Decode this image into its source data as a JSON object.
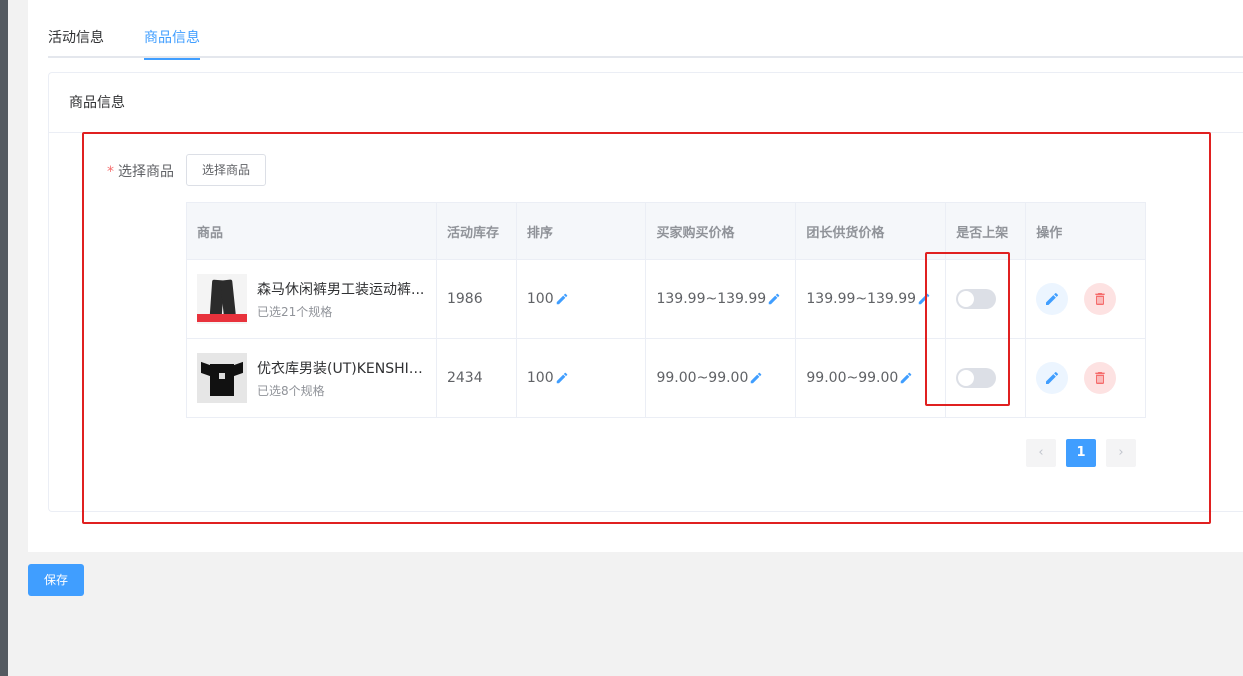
{
  "tabs": [
    {
      "label": "活动信息",
      "active": false
    },
    {
      "label": "商品信息",
      "active": true
    }
  ],
  "card": {
    "title": "商品信息"
  },
  "form": {
    "required_mark": "*",
    "select_label": "选择商品",
    "select_button": "选择商品"
  },
  "table": {
    "headers": [
      "商品",
      "活动库存",
      "排序",
      "买家购买价格",
      "团长供货价格",
      "是否上架",
      "操作"
    ],
    "rows": [
      {
        "name": "森马休闲裤男工装运动裤...",
        "spec": "已选21个规格",
        "stock": "1986",
        "sort": "100",
        "buyer_price": "139.99~139.99",
        "leader_price": "139.99~139.99",
        "on_shelf": false,
        "thumb_icon": "pants-product-image"
      },
      {
        "name": "优衣库男装(UT)KENSHI ...",
        "spec": "已选8个规格",
        "stock": "2434",
        "sort": "100",
        "buyer_price": "99.00~99.00",
        "leader_price": "99.00~99.00",
        "on_shelf": false,
        "thumb_icon": "tshirt-product-image"
      }
    ]
  },
  "pagination": {
    "current": "1",
    "prev_icon": "chevron-left-icon",
    "next_icon": "chevron-right-icon"
  },
  "save_button": "保存",
  "colors": {
    "primary": "#409eff",
    "danger": "#f56c6c",
    "highlight": "#e02020"
  }
}
